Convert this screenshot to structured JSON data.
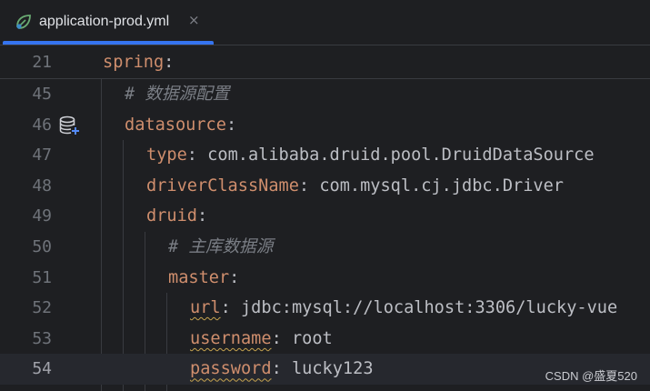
{
  "tab": {
    "title": "application-prod.yml",
    "close_glyph": "×",
    "icon": "spring-leaf-icon",
    "accent_color": "#3574f0"
  },
  "lines": [
    {
      "num": "21",
      "key": "spring",
      "colon": ":"
    },
    {
      "num": "45",
      "comment": "# 数据源配置"
    },
    {
      "num": "46",
      "key": "datasource",
      "colon": ":",
      "icon": "database-icon"
    },
    {
      "num": "47",
      "key": "type",
      "colon": ":",
      "value": " com.alibaba.druid.pool.DruidDataSource"
    },
    {
      "num": "48",
      "key": "driverClassName",
      "colon": ":",
      "value": " com.mysql.cj.jdbc.Driver"
    },
    {
      "num": "49",
      "key": "druid",
      "colon": ":"
    },
    {
      "num": "50",
      "comment": "# 主库数据源"
    },
    {
      "num": "51",
      "key": "master",
      "colon": ":"
    },
    {
      "num": "52",
      "key": "url",
      "colon": ":",
      "value": " jdbc:mysql://localhost:3306/lucky-vue"
    },
    {
      "num": "53",
      "key": "username",
      "colon": ":",
      "value": " root"
    },
    {
      "num": "54",
      "key": "password",
      "colon": ":",
      "value": " lucky123"
    }
  ],
  "colors": {
    "key": "#cf8e6d",
    "value": "#bcbec4",
    "comment": "#7a7e85",
    "line_number": "#6f737a",
    "background": "#1e1f22",
    "current_line": "#26282e"
  },
  "watermark": "CSDN @盛夏520"
}
